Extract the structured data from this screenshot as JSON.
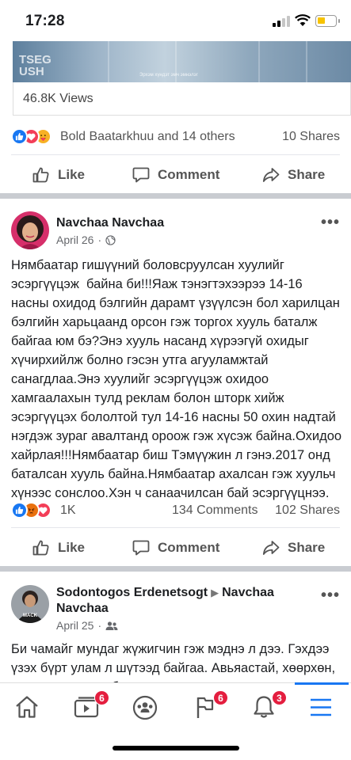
{
  "status_bar": {
    "time": "17:28"
  },
  "top_image": {
    "logo_line1": "TSEG",
    "logo_line2": "USH",
    "caption": "Эрхэм хүндэт эмч эмнэлэг"
  },
  "video": {
    "views": "46.8K Views"
  },
  "post1_footer": {
    "reactions_text": "Bold Baatarkhuu and 14 others",
    "shares": "10 Shares"
  },
  "actions": {
    "like": "Like",
    "comment": "Comment",
    "share": "Share"
  },
  "post2": {
    "author": "Navchaa Navchaa",
    "date": "April 26",
    "text": "Нямбаатар гишүүний боловсруулсан хуулийг эсэргүүцэж  байна би!!!Яаж тэнэгтэхээрээ 14-16 насны охидод бэлгийн дарамт үзүүлсэн бол харилцан бэлгийн харьцаанд орсон гэж торгох хууль баталж байгаа юм бэ?Энэ хууль насанд хүрээгүй охидыг хүчирхийлж болно гэсэн утга агууламжтай санагдлаа.Энэ хуулийг эсэргүүцэж охидоо хамгаалахын тулд реклам болон шторк хийж эсэргүүцэх бололтой тул 14-16 насны 50 охин надтай нэгдэж зураг авалтанд ороож гэж хүсэж байна.Охидоо хайрлая!!!Нямбаатар биш Тэмүүжин л гэнэ.2017 онд баталсан хууль байна.Нямбаатар ахалсан гэж хуульч хүнээс сонслоо.Хэн ч санаачилсан бай эсэргүүцнээ.",
    "reaction_count": "1K",
    "comments": "134 Comments",
    "shares": "102 Shares"
  },
  "post3": {
    "author": "Sodontogos Erdenetsogt",
    "target": "Navchaa",
    "target_line2": "Navchaa",
    "date": "April 25",
    "avatar_text": "MACK",
    "text": "Би чамайг мундаг жүжигчин гэж мэднэ л дээ. Гэхдээ үзэх бүрт улам л шүтээд байгаа. Авьяастай, хөөрхөн, ухаалаг, хэрсүү, бас үнэн гошин дүүдээ"
  },
  "bottom_nav": {
    "video_badge": "6",
    "marketplace_badge": "6",
    "notifications_badge": "3"
  },
  "colors": {
    "accent": "#1877f2",
    "badge": "#e41e3f",
    "divider": "#c9ccd1"
  }
}
